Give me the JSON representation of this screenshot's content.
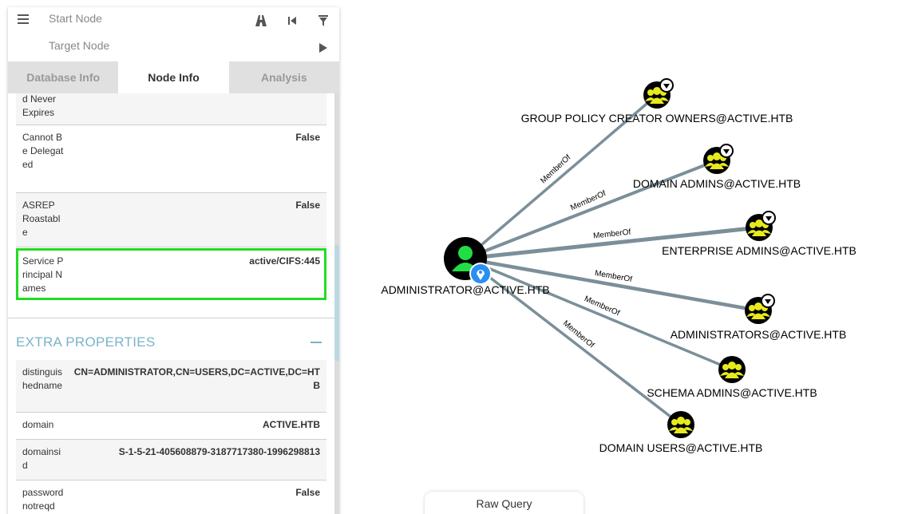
{
  "search": {
    "start_placeholder": "Start Node",
    "target_placeholder": "Target Node"
  },
  "tabs": [
    {
      "label": "Database Info",
      "active": false
    },
    {
      "label": "Node Info",
      "active": true
    },
    {
      "label": "Analysis",
      "active": false
    }
  ],
  "node_properties": [
    {
      "key": "d Never Expires",
      "value": ""
    },
    {
      "key": "Cannot Be Delegated",
      "value": "False"
    },
    {
      "key": "ASREP Roastable",
      "value": "False"
    },
    {
      "key": "Service Principal Names",
      "value": "active/CIFS:445"
    }
  ],
  "extra_properties": {
    "title": "EXTRA PROPERTIES",
    "rows": [
      {
        "key": "distinguishedname",
        "value": "CN=ADMINISTRATOR,CN=USERS,DC=ACTIVE,DC=HTB"
      },
      {
        "key": "domain",
        "value": "ACTIVE.HTB"
      },
      {
        "key": "domainsid",
        "value": "S-1-5-21-405608879-3187717380-1996298813"
      },
      {
        "key": "passwordnotreqd",
        "value": "False"
      }
    ]
  },
  "graph": {
    "center_node": "ADMINISTRATOR@ACTIVE.HTB",
    "nodes": [
      "GROUP POLICY CREATOR OWNERS@ACTIVE.HTB",
      "DOMAIN ADMINS@ACTIVE.HTB",
      "ENTERPRISE ADMINS@ACTIVE.HTB",
      "ADMINISTRATORS@ACTIVE.HTB",
      "SCHEMA ADMINS@ACTIVE.HTB",
      "DOMAIN USERS@ACTIVE.HTB"
    ],
    "edge_label": "MemberOf",
    "colors": {
      "edge": "#7b8f99",
      "group_fill": "#e8ea1c",
      "user_fill": "#22dd44"
    }
  },
  "raw_query_label": "Raw Query"
}
